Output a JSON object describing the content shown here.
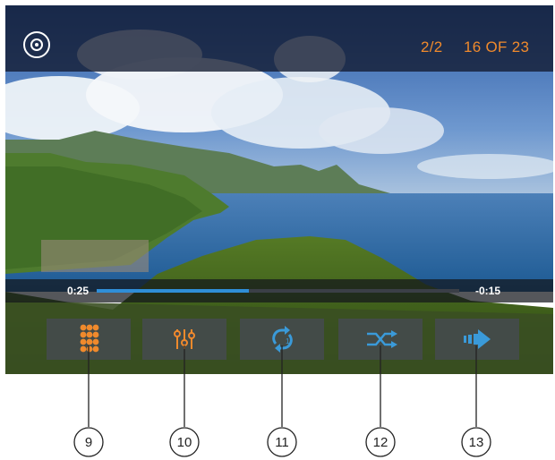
{
  "header": {
    "disc_icon": "disc-icon",
    "track_count": "2/2",
    "item_count": "16 OF 23"
  },
  "progress": {
    "elapsed": "0:25",
    "remaining": "-0:15",
    "fraction": 0.42,
    "color": "#2f8ed8"
  },
  "controls": [
    {
      "icon": "keypad-icon",
      "callout": "9"
    },
    {
      "icon": "equalizer-icon",
      "callout": "10"
    },
    {
      "icon": "repeat-icon",
      "callout": "11"
    },
    {
      "icon": "shuffle-icon",
      "callout": "12"
    },
    {
      "icon": "next-arrow-icon",
      "callout": "13"
    }
  ],
  "colors": {
    "accent": "#f08a2c",
    "progress": "#2f8ed8",
    "icon_blue": "#3a9ad9"
  }
}
